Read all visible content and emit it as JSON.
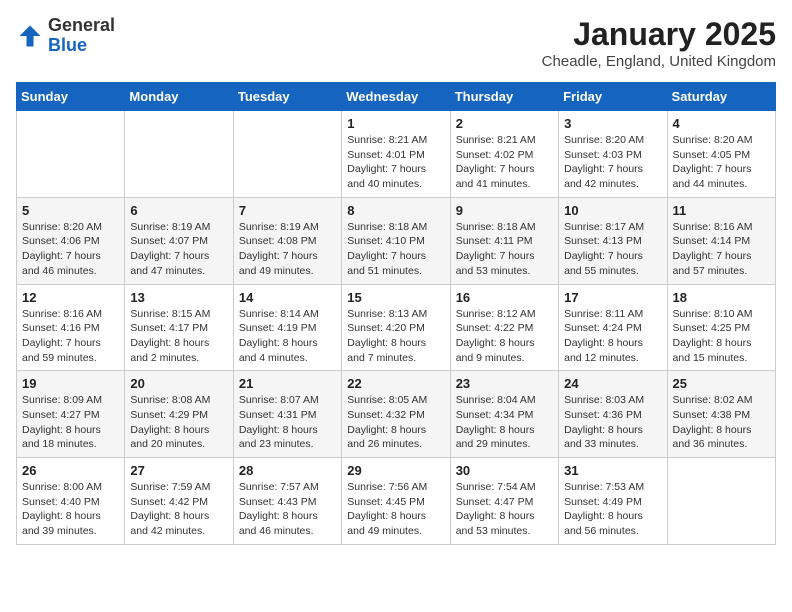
{
  "header": {
    "logo_general": "General",
    "logo_blue": "Blue",
    "title": "January 2025",
    "subtitle": "Cheadle, England, United Kingdom"
  },
  "days_of_week": [
    "Sunday",
    "Monday",
    "Tuesday",
    "Wednesday",
    "Thursday",
    "Friday",
    "Saturday"
  ],
  "weeks": [
    {
      "days": [
        {
          "number": "",
          "info": ""
        },
        {
          "number": "",
          "info": ""
        },
        {
          "number": "",
          "info": ""
        },
        {
          "number": "1",
          "info": "Sunrise: 8:21 AM\nSunset: 4:01 PM\nDaylight: 7 hours\nand 40 minutes."
        },
        {
          "number": "2",
          "info": "Sunrise: 8:21 AM\nSunset: 4:02 PM\nDaylight: 7 hours\nand 41 minutes."
        },
        {
          "number": "3",
          "info": "Sunrise: 8:20 AM\nSunset: 4:03 PM\nDaylight: 7 hours\nand 42 minutes."
        },
        {
          "number": "4",
          "info": "Sunrise: 8:20 AM\nSunset: 4:05 PM\nDaylight: 7 hours\nand 44 minutes."
        }
      ]
    },
    {
      "days": [
        {
          "number": "5",
          "info": "Sunrise: 8:20 AM\nSunset: 4:06 PM\nDaylight: 7 hours\nand 46 minutes."
        },
        {
          "number": "6",
          "info": "Sunrise: 8:19 AM\nSunset: 4:07 PM\nDaylight: 7 hours\nand 47 minutes."
        },
        {
          "number": "7",
          "info": "Sunrise: 8:19 AM\nSunset: 4:08 PM\nDaylight: 7 hours\nand 49 minutes."
        },
        {
          "number": "8",
          "info": "Sunrise: 8:18 AM\nSunset: 4:10 PM\nDaylight: 7 hours\nand 51 minutes."
        },
        {
          "number": "9",
          "info": "Sunrise: 8:18 AM\nSunset: 4:11 PM\nDaylight: 7 hours\nand 53 minutes."
        },
        {
          "number": "10",
          "info": "Sunrise: 8:17 AM\nSunset: 4:13 PM\nDaylight: 7 hours\nand 55 minutes."
        },
        {
          "number": "11",
          "info": "Sunrise: 8:16 AM\nSunset: 4:14 PM\nDaylight: 7 hours\nand 57 minutes."
        }
      ]
    },
    {
      "days": [
        {
          "number": "12",
          "info": "Sunrise: 8:16 AM\nSunset: 4:16 PM\nDaylight: 7 hours\nand 59 minutes."
        },
        {
          "number": "13",
          "info": "Sunrise: 8:15 AM\nSunset: 4:17 PM\nDaylight: 8 hours\nand 2 minutes."
        },
        {
          "number": "14",
          "info": "Sunrise: 8:14 AM\nSunset: 4:19 PM\nDaylight: 8 hours\nand 4 minutes."
        },
        {
          "number": "15",
          "info": "Sunrise: 8:13 AM\nSunset: 4:20 PM\nDaylight: 8 hours\nand 7 minutes."
        },
        {
          "number": "16",
          "info": "Sunrise: 8:12 AM\nSunset: 4:22 PM\nDaylight: 8 hours\nand 9 minutes."
        },
        {
          "number": "17",
          "info": "Sunrise: 8:11 AM\nSunset: 4:24 PM\nDaylight: 8 hours\nand 12 minutes."
        },
        {
          "number": "18",
          "info": "Sunrise: 8:10 AM\nSunset: 4:25 PM\nDaylight: 8 hours\nand 15 minutes."
        }
      ]
    },
    {
      "days": [
        {
          "number": "19",
          "info": "Sunrise: 8:09 AM\nSunset: 4:27 PM\nDaylight: 8 hours\nand 18 minutes."
        },
        {
          "number": "20",
          "info": "Sunrise: 8:08 AM\nSunset: 4:29 PM\nDaylight: 8 hours\nand 20 minutes."
        },
        {
          "number": "21",
          "info": "Sunrise: 8:07 AM\nSunset: 4:31 PM\nDaylight: 8 hours\nand 23 minutes."
        },
        {
          "number": "22",
          "info": "Sunrise: 8:05 AM\nSunset: 4:32 PM\nDaylight: 8 hours\nand 26 minutes."
        },
        {
          "number": "23",
          "info": "Sunrise: 8:04 AM\nSunset: 4:34 PM\nDaylight: 8 hours\nand 29 minutes."
        },
        {
          "number": "24",
          "info": "Sunrise: 8:03 AM\nSunset: 4:36 PM\nDaylight: 8 hours\nand 33 minutes."
        },
        {
          "number": "25",
          "info": "Sunrise: 8:02 AM\nSunset: 4:38 PM\nDaylight: 8 hours\nand 36 minutes."
        }
      ]
    },
    {
      "days": [
        {
          "number": "26",
          "info": "Sunrise: 8:00 AM\nSunset: 4:40 PM\nDaylight: 8 hours\nand 39 minutes."
        },
        {
          "number": "27",
          "info": "Sunrise: 7:59 AM\nSunset: 4:42 PM\nDaylight: 8 hours\nand 42 minutes."
        },
        {
          "number": "28",
          "info": "Sunrise: 7:57 AM\nSunset: 4:43 PM\nDaylight: 8 hours\nand 46 minutes."
        },
        {
          "number": "29",
          "info": "Sunrise: 7:56 AM\nSunset: 4:45 PM\nDaylight: 8 hours\nand 49 minutes."
        },
        {
          "number": "30",
          "info": "Sunrise: 7:54 AM\nSunset: 4:47 PM\nDaylight: 8 hours\nand 53 minutes."
        },
        {
          "number": "31",
          "info": "Sunrise: 7:53 AM\nSunset: 4:49 PM\nDaylight: 8 hours\nand 56 minutes."
        },
        {
          "number": "",
          "info": ""
        }
      ]
    }
  ]
}
